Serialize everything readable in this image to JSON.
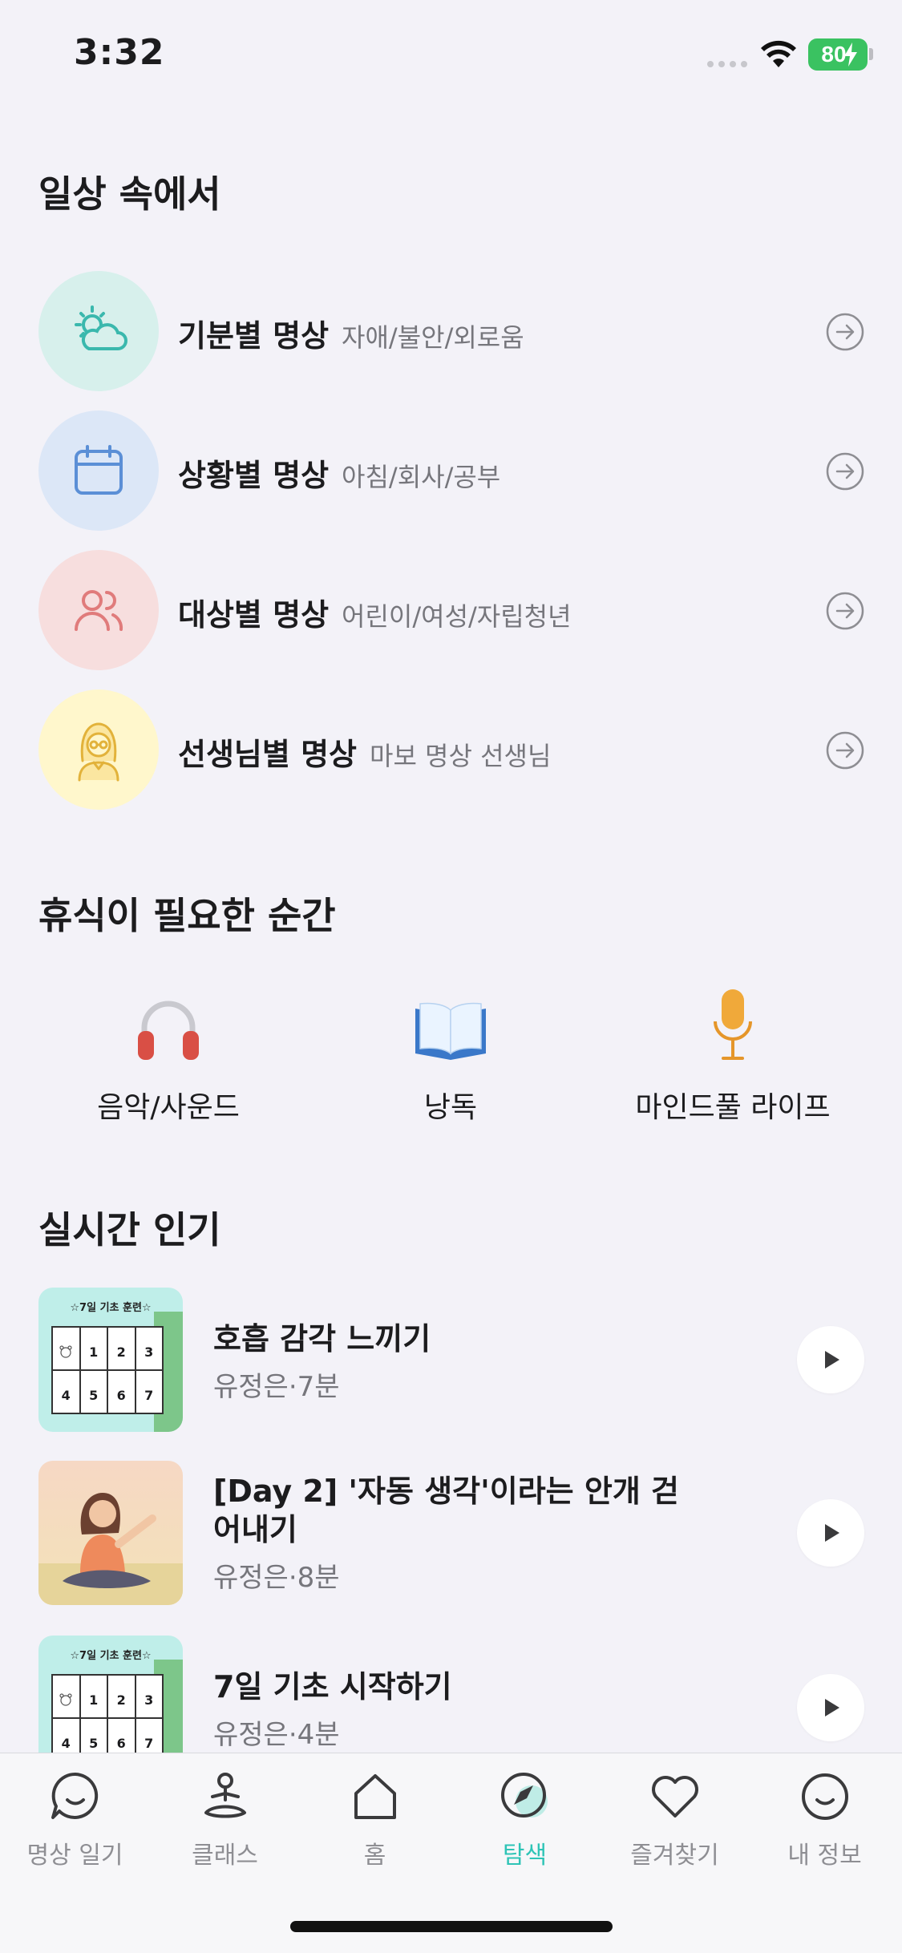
{
  "status": {
    "time": "3:32",
    "battery": "80"
  },
  "colors": {
    "accent": "#2ec4b6",
    "mood_bg": "#d7f0ec",
    "situation_bg": "#dce7f7",
    "target_bg": "#f7dede",
    "teacher_bg": "#fff7cc"
  },
  "daily": {
    "title": "일상 속에서",
    "items": [
      {
        "title": "기분별 명상",
        "sub": "자애/불안/외로움",
        "icon": "weather-icon"
      },
      {
        "title": "상황별 명상",
        "sub": "아침/회사/공부",
        "icon": "calendar-icon"
      },
      {
        "title": "대상별 명상",
        "sub": "어린이/여성/자립청년",
        "icon": "people-icon"
      },
      {
        "title": "선생님별 명상",
        "sub": "마보 명상 선생님",
        "icon": "teacher-icon"
      }
    ]
  },
  "rest": {
    "title": "휴식이 필요한 순간",
    "items": [
      {
        "label": "음악/사운드",
        "icon": "headphones-icon"
      },
      {
        "label": "낭독",
        "icon": "book-icon"
      },
      {
        "label": "마인드풀 라이프",
        "icon": "microphone-icon"
      }
    ]
  },
  "popular": {
    "title": "실시간 인기",
    "plan_thumb": {
      "title": "☆7일 기초 훈련☆",
      "days": [
        "1",
        "2",
        "3",
        "4",
        "5",
        "6",
        "7"
      ]
    },
    "items": [
      {
        "title": "호흡 감각 느끼기",
        "meta": "유정은·7분"
      },
      {
        "title": "[Day 2] '자동 생각'이라는 안개 걷어내기",
        "meta": "유정은·8분"
      },
      {
        "title": "7일 기초 시작하기",
        "meta": "유정은·4분"
      }
    ]
  },
  "tabs": [
    {
      "label": "명상 일기",
      "icon": "chat-smile-icon"
    },
    {
      "label": "클래스",
      "icon": "meditation-icon"
    },
    {
      "label": "홈",
      "icon": "home-icon"
    },
    {
      "label": "탐색",
      "icon": "compass-icon",
      "active": true
    },
    {
      "label": "즐겨찾기",
      "icon": "heart-icon"
    },
    {
      "label": "내 정보",
      "icon": "profile-smile-icon"
    }
  ]
}
